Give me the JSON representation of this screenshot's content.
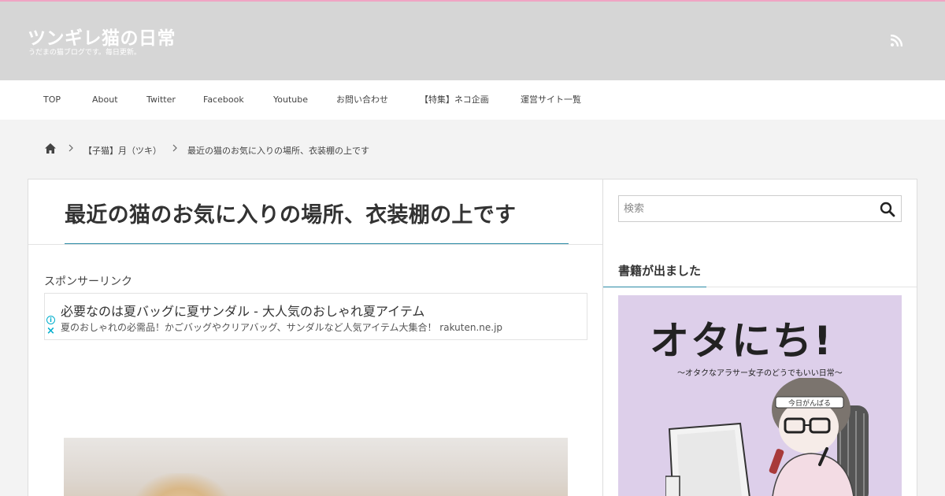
{
  "header": {
    "site_title": "ツンギレ猫の日常",
    "site_description": "うだまの猫ブログです。毎日更新。",
    "rss_icon": "rss-icon",
    "accent_color": "#f0a5c4",
    "background": "#d6d6d6"
  },
  "nav": {
    "items": [
      {
        "label": "TOP"
      },
      {
        "label": "About"
      },
      {
        "label": "Twitter"
      },
      {
        "label": "Facebook"
      },
      {
        "label": "Youtube"
      },
      {
        "label": "お問い合わせ"
      },
      {
        "label": "【特集】ネコ企画"
      },
      {
        "label": "運営サイト一覧"
      }
    ]
  },
  "breadcrumb": {
    "home_icon": "home-icon",
    "items": [
      {
        "label": "【子猫】月（ツキ）"
      },
      {
        "label": "最近の猫のお気に入りの場所、衣装棚の上です"
      }
    ]
  },
  "post": {
    "title": "最近の猫のお気に入りの場所、衣装棚の上です",
    "sponsor_label": "スポンサーリンク",
    "title_underline_color": "#2a8aa5"
  },
  "ad": {
    "title": "必要なのは夏バッグに夏サンダル - 大人気のおしゃれ夏アイテム",
    "description": "夏のおしゃれの必需品！かごバッグやクリアバッグ、サンダルなど人気アイテム大集合！ rakuten.ne.jp",
    "info_icon": "ad-info-icon",
    "close_icon": "ad-close-icon",
    "accent_color": "#00aecd"
  },
  "sidebar": {
    "search_placeholder": "検索",
    "search_icon": "search-icon",
    "widget_title": "書籍が出ました",
    "book": {
      "title": "オタにち!",
      "subtitle": "〜オタクなアラサー女子のどうでもいい日常〜",
      "headband_text": "今日がんばる"
    }
  }
}
